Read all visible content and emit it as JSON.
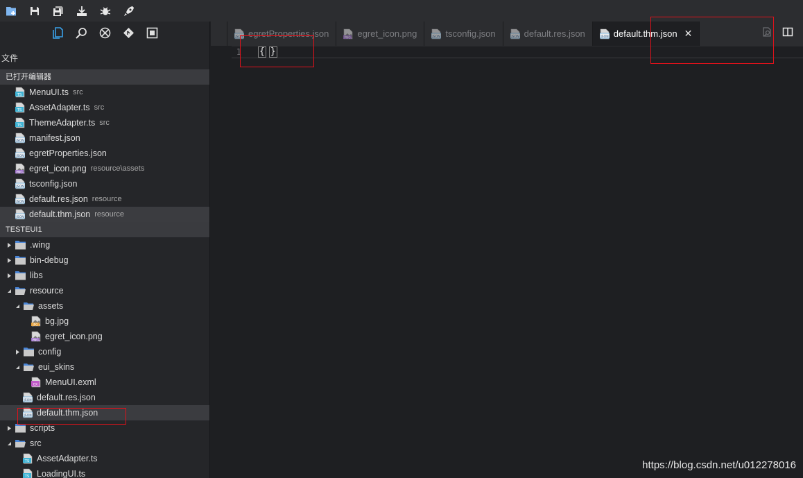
{
  "colors": {
    "accent_blue": "#3aa0e8",
    "ts_icon": "#3fb3d4",
    "json_icon": "#6bb0e0",
    "exml_icon": "#c05ac8",
    "jpg_icon": "#e5a03a",
    "folder": "#4a86d8",
    "annotation": "#e0121b"
  },
  "toolbar": {
    "buttons": [
      {
        "name": "new-project-icon"
      },
      {
        "name": "save-icon"
      },
      {
        "name": "save-all-icon"
      },
      {
        "name": "publish-icon"
      },
      {
        "name": "debug-icon"
      },
      {
        "name": "run-icon"
      }
    ]
  },
  "sidebar": {
    "icons": [
      "explorer-icon",
      "search-icon",
      "debug-icon",
      "git-icon",
      "extensions-icon"
    ],
    "title": "文件",
    "open_editors": {
      "title": "已打开编辑器",
      "items": [
        {
          "name": "MenuUI.ts",
          "desc": "src",
          "type": "ts"
        },
        {
          "name": "AssetAdapter.ts",
          "desc": "src",
          "type": "ts"
        },
        {
          "name": "ThemeAdapter.ts",
          "desc": "src",
          "type": "ts"
        },
        {
          "name": "manifest.json",
          "desc": "",
          "type": "json"
        },
        {
          "name": "egretProperties.json",
          "desc": "",
          "type": "json"
        },
        {
          "name": "egret_icon.png",
          "desc": "resource\\assets",
          "type": "png"
        },
        {
          "name": "tsconfig.json",
          "desc": "",
          "type": "json"
        },
        {
          "name": "default.res.json",
          "desc": "resource",
          "type": "json"
        },
        {
          "name": "default.thm.json",
          "desc": "resource",
          "type": "json"
        }
      ]
    },
    "project": {
      "title": "TESTEUI1",
      "tree": [
        {
          "label": ".wing",
          "kind": "folder",
          "depth": 0,
          "open": false
        },
        {
          "label": "bin-debug",
          "kind": "folder",
          "depth": 0,
          "open": false
        },
        {
          "label": "libs",
          "kind": "folder",
          "depth": 0,
          "open": false
        },
        {
          "label": "resource",
          "kind": "folder",
          "depth": 0,
          "open": true
        },
        {
          "label": "assets",
          "kind": "folder",
          "depth": 1,
          "open": true
        },
        {
          "label": "bg.jpg",
          "kind": "jpg",
          "depth": 2
        },
        {
          "label": "egret_icon.png",
          "kind": "png",
          "depth": 2
        },
        {
          "label": "config",
          "kind": "folder",
          "depth": 1,
          "open": false
        },
        {
          "label": "eui_skins",
          "kind": "folder",
          "depth": 1,
          "open": true
        },
        {
          "label": "MenuUI.exml",
          "kind": "exml",
          "depth": 2
        },
        {
          "label": "default.res.json",
          "kind": "json",
          "depth": 1
        },
        {
          "label": "default.thm.json",
          "kind": "json",
          "depth": 1
        },
        {
          "label": "scripts",
          "kind": "folder",
          "depth": 0,
          "open": false
        },
        {
          "label": "src",
          "kind": "folder",
          "depth": 0,
          "open": true
        },
        {
          "label": "AssetAdapter.ts",
          "kind": "ts",
          "depth": 1
        },
        {
          "label": "LoadingUI.ts",
          "kind": "ts",
          "depth": 1
        }
      ]
    }
  },
  "tabs": [
    {
      "label": "egretProperties.json",
      "type": "json",
      "active": false
    },
    {
      "label": "egret_icon.png",
      "type": "png",
      "active": false
    },
    {
      "label": "tsconfig.json",
      "type": "json",
      "active": false
    },
    {
      "label": "default.res.json",
      "type": "json",
      "active": false
    },
    {
      "label": "default.thm.json",
      "type": "json",
      "active": true
    }
  ],
  "tab_close": "✕",
  "editor": {
    "line_number": "1",
    "open_brace": "{",
    "close_brace": "}"
  },
  "watermark": "https://blog.csdn.net/u012278016"
}
